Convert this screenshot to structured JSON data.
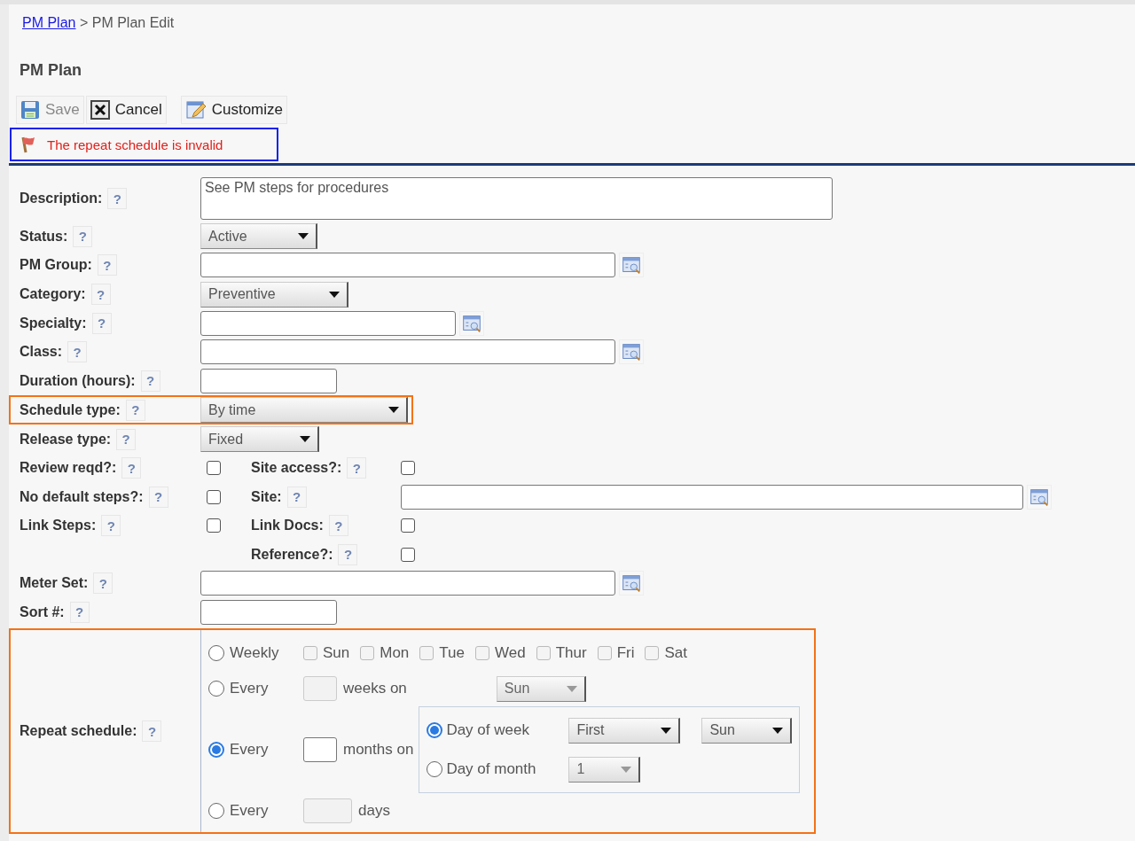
{
  "breadcrumb": {
    "link": "PM Plan",
    "separator": ">",
    "current": "PM Plan Edit"
  },
  "title": "PM Plan",
  "toolbar": [
    {
      "kind": "save",
      "label": "Save",
      "disabled": true
    },
    {
      "kind": "cancel",
      "label": "Cancel",
      "disabled": false
    },
    {
      "kind": "customize",
      "label": "Customize",
      "disabled": false
    }
  ],
  "error": "The repeat schedule is invalid",
  "rows": [
    {
      "kind": "textarea",
      "label": "Description:",
      "help": "?",
      "value": "See PM steps for procedures",
      "invalid": false
    },
    {
      "kind": "select",
      "label": "Status:",
      "help": "?",
      "value": "Active",
      "invalid": false
    },
    {
      "kind": "lookup",
      "label": "PM Group:",
      "help": "?",
      "invalid": false
    },
    {
      "kind": "select",
      "label": "Category:",
      "help": "?",
      "value": "Preventive",
      "invalid": false
    },
    {
      "kind": "lookup",
      "label": "Specialty:",
      "help": "?",
      "invalid": false
    },
    {
      "kind": "lookup",
      "label": "Class:",
      "help": "?",
      "invalid": false
    },
    {
      "kind": "text",
      "label": "Duration (hours):",
      "help": "?",
      "invalid": false
    },
    {
      "kind": "select",
      "label": "Schedule type:",
      "help": "?",
      "value": "By time",
      "invalid": true
    },
    {
      "kind": "select",
      "label": "Release type:",
      "help": "?",
      "value": "Fixed",
      "invalid": false
    },
    {
      "kind": "pair",
      "label": "Review reqd?:",
      "help": "?",
      "checked": false,
      "invalid": false,
      "right": {
        "kind": "checkbox",
        "label": "Site access?:",
        "help": "?",
        "checked": false
      }
    },
    {
      "kind": "pair",
      "label": "No default steps?:",
      "help": "?",
      "checked": false,
      "invalid": false,
      "right": {
        "kind": "lookup",
        "label": "Site:",
        "help": "?"
      }
    },
    {
      "kind": "pair",
      "label": "Link Steps:",
      "help": "?",
      "checked": false,
      "invalid": false,
      "right": {
        "kind": "checkbox",
        "label": "Link Docs:",
        "help": "?",
        "checked": false
      }
    },
    {
      "kind": "pair",
      "invalid": false,
      "right": {
        "kind": "checkbox",
        "label": "Reference?:",
        "help": "?",
        "checked": false
      }
    },
    {
      "kind": "lookup",
      "label": "Meter Set:",
      "help": "?",
      "invalid": false
    },
    {
      "kind": "text",
      "label": "Sort #:",
      "help": "?",
      "invalid": false
    }
  ],
  "repeat": {
    "label": "Repeat schedule:",
    "help": "?",
    "invalid": true,
    "options": [
      {
        "kind": "weekly",
        "label": "Weekly",
        "selected": false,
        "days": [
          {
            "label": "Sun",
            "checked": false
          },
          {
            "label": "Mon",
            "checked": false
          },
          {
            "label": "Tue",
            "checked": false
          },
          {
            "label": "Wed",
            "checked": false
          },
          {
            "label": "Thur",
            "checked": false
          },
          {
            "label": "Fri",
            "checked": false
          },
          {
            "label": "Sat",
            "checked": false
          }
        ]
      },
      {
        "kind": "weeks",
        "label": "Every",
        "selected": false,
        "unit": "weeks on",
        "day": "Sun"
      },
      {
        "kind": "months",
        "label": "Every",
        "selected": true,
        "unit": "months on",
        "modes": [
          {
            "kind": "week",
            "label": "Day of week",
            "selected": true,
            "ordinal": "First",
            "day": "Sun"
          },
          {
            "kind": "month",
            "label": "Day of month",
            "selected": false,
            "day": "1"
          }
        ]
      },
      {
        "kind": "days",
        "label": "Every",
        "selected": false,
        "unit": "days"
      }
    ]
  }
}
